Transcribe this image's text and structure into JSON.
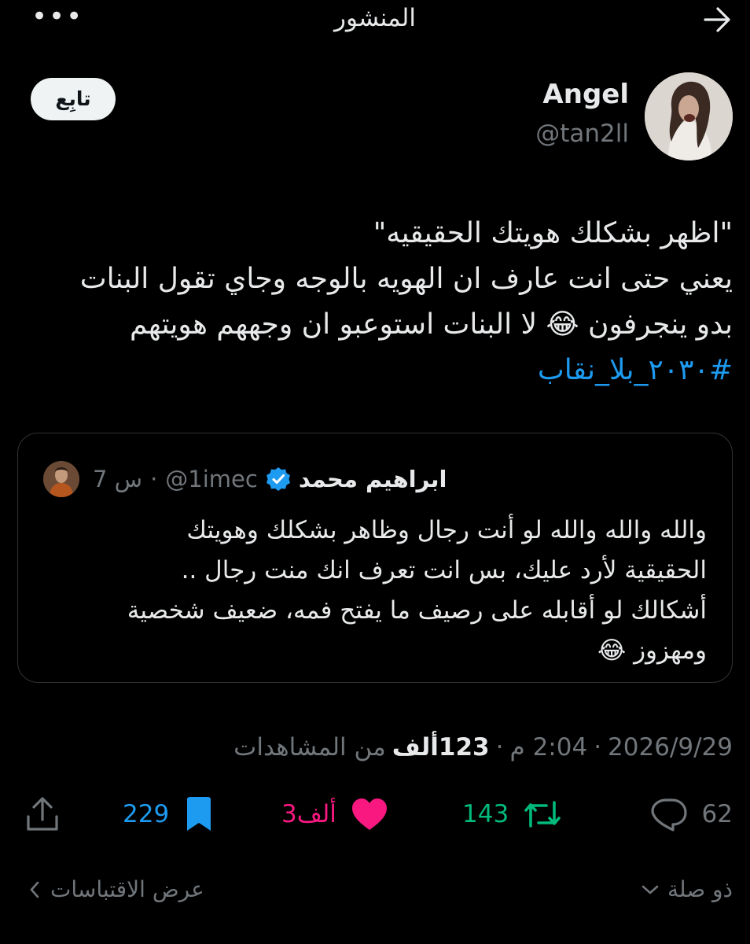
{
  "header": {
    "title": "المنشور",
    "more_icon": "more-horizontal-icon",
    "back_icon": "arrow-right-icon"
  },
  "author": {
    "name": "Angel",
    "handle": "@tan2ll",
    "follow_label": "تابِع"
  },
  "tweet": {
    "lines": [
      "\"اظهر بشكلك هويتك الحقيقيه\"",
      "يعني حتى انت عارف ان الهويه بالوجه وجاي تقول البنات",
      "بدو ينجرفون 😂 لا البنات استوعبو ان وجههم هويتهم"
    ],
    "hashtag": "#٢٠٣٠_بلا_نقاب"
  },
  "quote": {
    "name": "ابراهيم محمد",
    "handle": "@1imec",
    "time": "7 س",
    "separator": "·",
    "lines": [
      "والله والله والله لو أنت رجال وظاهر بشكلك وهويتك",
      "الحقيقية لأرد عليك، بس انت تعرف انك منت رجال ..",
      "أشكالك لو أقابله على رصيف ما يفتح فمه، ضعيف شخصية",
      "ومهزوز 😂"
    ]
  },
  "meta": {
    "date": "2026/9/29",
    "sep1": "·",
    "time": "2:04 م",
    "sep2": "·",
    "views_count": "123ألف",
    "views_label": "من المشاهدات"
  },
  "actions": {
    "replies": "62",
    "retweets": "143",
    "likes": "3ألف",
    "bookmarks": "229"
  },
  "bottom": {
    "relevant": "ذو صلة",
    "quotes": "عرض الاقتباسات"
  },
  "colors": {
    "background": "#000000",
    "text": "#e7e9ea",
    "muted": "#71767b",
    "link": "#1d9bf0",
    "retweet": "#00ba7c",
    "like": "#f91880",
    "bookmark": "#1d9bf0"
  }
}
